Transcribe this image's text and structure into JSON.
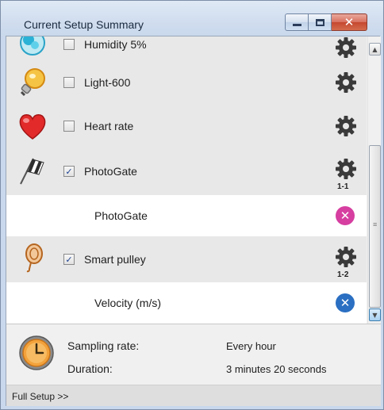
{
  "window": {
    "title": "Current Setup Summary",
    "close_glyph": "✕"
  },
  "sensors": [
    {
      "icon": "humidity-icon",
      "label": "Humidity 5%",
      "checked": false
    },
    {
      "icon": "light-bulb-icon",
      "label": "Light-600",
      "checked": false
    },
    {
      "icon": "heart-icon",
      "label": "Heart rate",
      "checked": false
    },
    {
      "icon": "photogate-flag-icon",
      "label": "PhotoGate",
      "checked": true,
      "badge": "1-1",
      "measurement": {
        "label": "PhotoGate",
        "button": "pink-close",
        "glyph": "✕"
      }
    },
    {
      "icon": "smart-pulley-icon",
      "label": "Smart pulley",
      "checked": true,
      "badge": "1-2",
      "measurement": {
        "label": "Velocity (m/s)",
        "button": "blue-close",
        "glyph": "✕"
      }
    }
  ],
  "check_glyph": "✓",
  "scrollbar": {
    "up_glyph": "▲",
    "down_glyph": "▼",
    "grip_glyph": "≡"
  },
  "sampling": {
    "label": "Sampling rate:",
    "value": "Every hour"
  },
  "duration": {
    "label": "Duration:",
    "value": "3 minutes 20 seconds"
  },
  "footer": {
    "full_setup_label": "Full Setup >>"
  },
  "colors": {
    "pink_button": "#d63ea0",
    "blue_button": "#2a6fc2",
    "row_bg": "#e8e8e8"
  }
}
